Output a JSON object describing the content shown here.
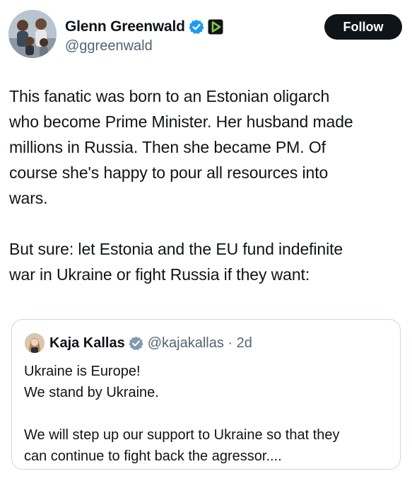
{
  "author": {
    "display_name": "Glenn Greenwald",
    "handle": "@ggreenwald",
    "avatar_icon": "avatar-photo-family",
    "verified_icon": "verified-badge-icon",
    "affiliate_icon": "rumble-play-icon"
  },
  "follow_label": "Follow",
  "tweet": {
    "text": "This fanatic was born to an Estonian oligarch\nwho become Prime Minister. Her husband made\nmillions in Russia. Then she became PM. Of\ncourse she's happy to pour all resources into\nwars.\n\nBut sure: let Estonia and the EU fund indefinite\nwar in Ukraine or fight Russia if they want:"
  },
  "quote": {
    "display_name": "Kaja Kallas",
    "handle_time": "@kajakallas · 2d",
    "text": "Ukraine is Europe!\nWe stand by Ukraine.\n\nWe will step up our support to Ukraine so that they\ncan continue to fight back the agressor...."
  },
  "colors": {
    "text": "#0f1419",
    "secondary": "#536471",
    "verified_blue": "#1d9bf0",
    "verified_gray": "#829aab",
    "follow_bg": "#0f1419",
    "affiliate_green": "#85c742",
    "border": "#cfd9de"
  }
}
